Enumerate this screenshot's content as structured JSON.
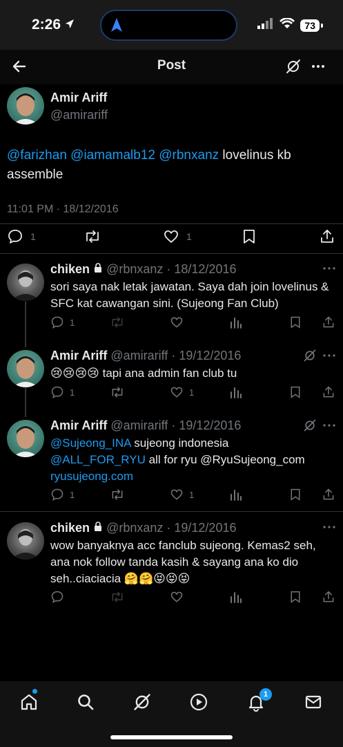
{
  "status_bar": {
    "time": "2:26",
    "battery": "73"
  },
  "header": {
    "title": "Post"
  },
  "main_post": {
    "name": "Amir Ariff",
    "handle": "@amirariff",
    "mentions": [
      "@farizhan",
      "@iamamalb12",
      "@rbnxanz"
    ],
    "text": "lovelinus kb assemble",
    "timestamp": "11:01 PM · 18/12/2016",
    "reply_count": "1",
    "like_count": "1"
  },
  "replies": [
    {
      "name": "chiken",
      "handle": "@rbnxanz",
      "date": "· 18/12/2016",
      "locked": true,
      "text": "sori saya nak letak jawatan. Saya dah join lovelinus & SFC kat cawangan sini. (Sujeong Fan Club)",
      "reply_count": "1",
      "like_count": ""
    },
    {
      "name": "Amir Ariff",
      "handle": "@amirariff",
      "date": "· 19/12/2016",
      "emojis": "😢😢😢😢",
      "text": "tapi ana admin fan club tu",
      "reply_count": "1",
      "like_count": "1"
    },
    {
      "name": "Amir Ariff",
      "handle": "@amirariff",
      "date": "· 19/12/2016",
      "line1_link": "@Sujeong_INA",
      "line1_text": "sujeong indonesia",
      "line2_link": "@ALL_FOR_RYU",
      "line2_text": "all for ryu @RyuSujeong_com",
      "line3_link": "ryusujeong.com",
      "reply_count": "1",
      "like_count": "1"
    },
    {
      "name": "chiken",
      "handle": "@rbnxanz",
      "date": "· 19/12/2016",
      "locked": true,
      "text": "wow banyaknya acc fanclub sujeong. Kemas2 seh, ana nok follow tanda kasih & sayang ana ko dio seh..ciaciacia",
      "emojis": "🤗🤗😝😝😝"
    }
  ],
  "bottom_nav": {
    "notifications_badge": "1"
  },
  "colors": {
    "accent": "#1d9bf0",
    "background": "#000000",
    "muted": "#71767b"
  },
  "icons": [
    "back-arrow-icon",
    "grok-icon",
    "more-icon",
    "reply-icon",
    "retweet-icon",
    "like-icon",
    "bookmark-icon",
    "share-icon",
    "views-icon",
    "lock-icon",
    "home-icon",
    "search-icon",
    "play-icon",
    "bell-icon",
    "mail-icon"
  ]
}
